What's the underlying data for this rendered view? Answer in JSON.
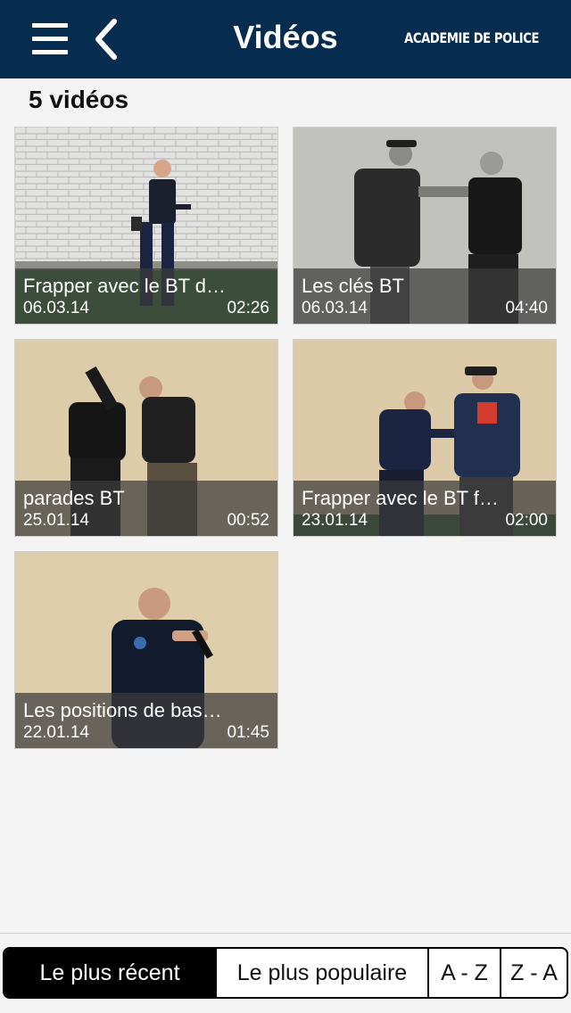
{
  "header": {
    "title": "Vidéos",
    "logo_text": "ACADEMIE DE POLICE",
    "menu_icon": "hamburger-menu-icon",
    "back_icon": "chevron-left-icon",
    "background": "#062c4f"
  },
  "video_count": "5 vidéos",
  "videos": [
    {
      "title": "Frapper avec le BT d…",
      "date": "06.03.14",
      "duration": "02:26"
    },
    {
      "title": "Les clés BT",
      "date": "06.03.14",
      "duration": "04:40"
    },
    {
      "title": "parades BT",
      "date": "25.01.14",
      "duration": "00:52"
    },
    {
      "title": "Frapper avec le BT f…",
      "date": "23.01.14",
      "duration": "02:00"
    },
    {
      "title": "Les positions de bas…",
      "date": "22.01.14",
      "duration": "01:45"
    }
  ],
  "sort_bar": {
    "options": [
      "Le plus récent",
      "Le plus populaire",
      "A - Z",
      "Z - A"
    ],
    "selected": "Le plus récent"
  }
}
